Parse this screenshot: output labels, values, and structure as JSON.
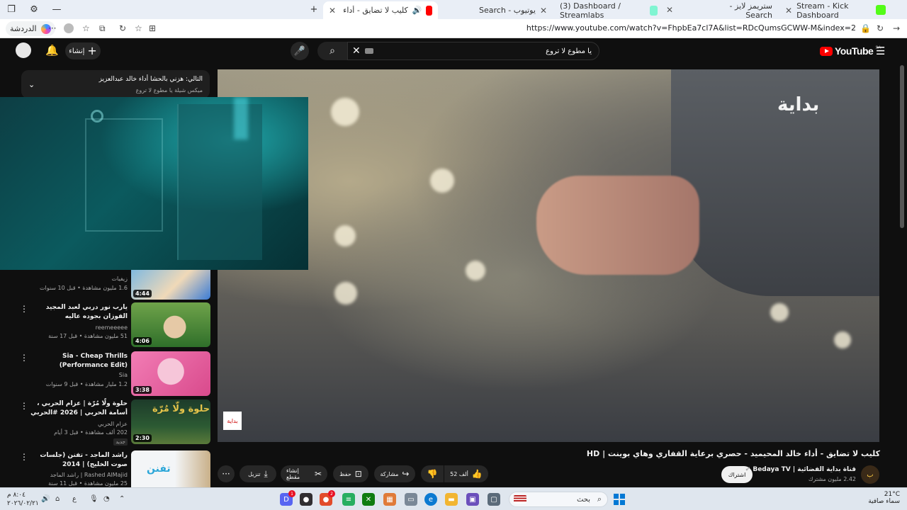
{
  "browser": {
    "tabs": [
      {
        "label": "كليب لا تضايق - أداء خالد المحي...",
        "active": true
      },
      {
        "label": "يوتيوب - Search"
      },
      {
        "label": "(3) Dashboard / Streamlabs"
      },
      {
        "label": "ستريمز لايز - Search"
      },
      {
        "label": "Stream - Kick Dashboard"
      }
    ],
    "new_tab": "+",
    "profile_label": "الدردشة",
    "url": "https://www.youtube.com/watch?v=FhpbEa7cl7A&list=RDcQumsGCWW-M&index=2"
  },
  "youtube": {
    "logo_text": "YouTube",
    "logo_region": "SA",
    "search_query": "يا مطوع لا تروع",
    "create_label": "إنشاء",
    "upnext": {
      "title": "التالي: هزني بالحشا أداء خالد عبدالعزيز",
      "subtitle": "ميكس شيلة يا مطوع لا تروع"
    },
    "sidebar_items": [
      {
        "title": "",
        "channel": "زيفيات",
        "meta": "1.6 مليون مشاهدة • قبل 10 سنوات",
        "duration": "4:44",
        "colors": [
          "#7fb9e0",
          "#f0d9b8",
          "#3a7bd5"
        ]
      },
      {
        "title": "يارب نور دربي لعبد المجيد الفوزان بجوده عاليه",
        "channel": "reemeeeee",
        "meta": "51 مليون مشاهدة • قبل 17 سنة",
        "duration": "4:06",
        "colors": [
          "#8fbf5a",
          "#e6c9a6",
          "#2f6f2a"
        ]
      },
      {
        "title": "Sia - Cheap Thrills (Performance Edit)",
        "channel": "Sia",
        "meta": "1.2 مليار مشاهدة • قبل 9 سنوات",
        "duration": "3:38",
        "colors": [
          "#f27db5",
          "#f6c6d9",
          "#d94a8c"
        ]
      },
      {
        "title": "حلوة ولّا مُرّة | عزام الحربي ، أسامة الحربي | 2026 #الحربي",
        "channel": "عزام الحربي",
        "meta": "202 ألف مشاهدة • قبل 3 أيام",
        "badge": "جديد",
        "duration": "2:30",
        "colors": [
          "#1d3b2a",
          "#e5c34a",
          "#5a7a3a"
        ]
      },
      {
        "title": "راشد الماجد - تفنن (جلسات صوت الخليج) | 2014",
        "channel": "Rashed AlMajid | راشد الماجد",
        "meta": "25 مليون مشاهدة • قبل 11 سنة",
        "duration": "",
        "colors": [
          "#f3f5f7",
          "#2aa6d8",
          "#c9b089"
        ]
      }
    ],
    "video": {
      "watermark": "بداية",
      "watermark_small": "بداية",
      "title": "كليب لا تضايق - أداء خالد المحيميد - حصري برعاية القفاري وهاي بوينت | HD",
      "channel": "قناة بداية الفضائية | Bedaya TV",
      "subscribers": "2.42 مليون مشترك",
      "subscribe_label": "اشتراك",
      "actions": {
        "like_count": "52 ألف",
        "share": "مشاركة",
        "save": "حفظ",
        "clip": "إنشاء مقطع",
        "download": "تنزيل"
      }
    }
  },
  "taskbar": {
    "search_label": "بحث",
    "weather_temp": "21°C",
    "weather_desc": "سماء صافية",
    "time": "٨:٠٤ م",
    "date": "٢٠٢٦/٠٢/٢١",
    "lang": "ع",
    "badges": [
      "1",
      "2"
    ]
  }
}
